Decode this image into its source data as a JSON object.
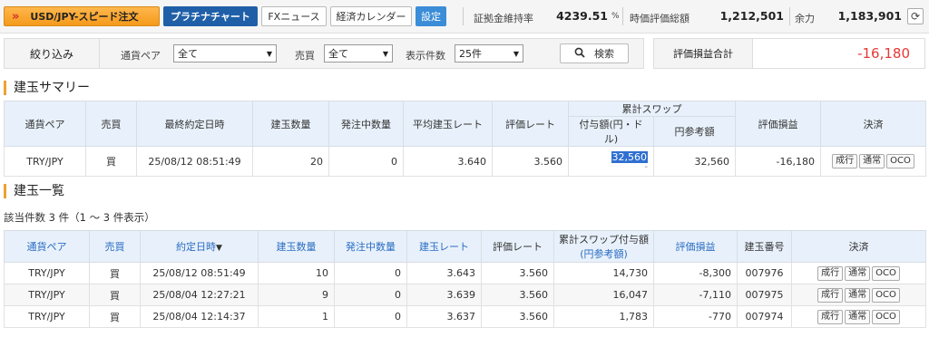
{
  "topbar": {
    "speed_order_label": "USD/JPY-スピード注文",
    "platinum_chart_label": "プラチナチャート",
    "fx_news_label": "FXニュース",
    "econ_calendar_label": "経済カレンダー",
    "settings_label": "設定",
    "margin_rate_label": "証拠金維持率",
    "margin_rate_value": "4239.51",
    "margin_rate_unit": "%",
    "valuation_total_label": "時価評価総額",
    "valuation_total_value": "1,212,501",
    "available_label": "余力",
    "available_value": "1,183,901",
    "refresh_icon_glyph": "⟳"
  },
  "filter": {
    "title": "絞り込み",
    "pair_label": "通貨ペア",
    "pair_value": "全て",
    "side_label": "売買",
    "side_value": "全て",
    "count_label": "表示件数",
    "count_value": "25件",
    "search_label": "検索",
    "search_icon_glyph": "🔍"
  },
  "pl_total": {
    "label": "評価損益合計",
    "value": "-16,180"
  },
  "summary": {
    "title": "建玉サマリー",
    "headers": {
      "pair": "通貨ペア",
      "side": "売買",
      "last_date": "最終約定日時",
      "qty": "建玉数量",
      "pending": "発注中数量",
      "avg_rate": "平均建玉レート",
      "eval_rate": "評価レート",
      "swap_group": "累計スワップ",
      "swap_amount": "付与額(円・ドル)",
      "swap_yen": "円参考額",
      "pl": "評価損益",
      "settle": "決済"
    },
    "row": {
      "pair": "TRY/JPY",
      "side": "買",
      "last_date": "25/08/12 08:51:49",
      "qty": "20",
      "pending": "0",
      "avg_rate": "3.640",
      "eval_rate": "3.560",
      "swap_amount": "32,560",
      "swap_sub": "-",
      "swap_yen": "32,560",
      "pl": "-16,180"
    }
  },
  "positions": {
    "title": "建玉一覧",
    "count_text": "該当件数 3 件（1 ～ 3 件表示）",
    "headers": {
      "pair": "通貨ペア",
      "side": "売買",
      "date": "約定日時",
      "sort_glyph": "▼",
      "qty": "建玉数量",
      "pending": "発注中数量",
      "rate": "建玉レート",
      "eval_rate": "評価レート",
      "swap_line1": "累計スワップ付与額",
      "swap_line2": "(円参考額)",
      "pl": "評価損益",
      "id": "建玉番号",
      "settle": "決済"
    },
    "rows": [
      {
        "pair": "TRY/JPY",
        "side": "買",
        "date": "25/08/12 08:51:49",
        "qty": "10",
        "pending": "0",
        "rate": "3.643",
        "eval_rate": "3.560",
        "swap": "14,730",
        "pl": "-8,300",
        "id": "007976"
      },
      {
        "pair": "TRY/JPY",
        "side": "買",
        "date": "25/08/04 12:27:21",
        "qty": "9",
        "pending": "0",
        "rate": "3.639",
        "eval_rate": "3.560",
        "swap": "16,047",
        "pl": "-7,110",
        "id": "007975"
      },
      {
        "pair": "TRY/JPY",
        "side": "買",
        "date": "25/08/04 12:14:37",
        "qty": "1",
        "pending": "0",
        "rate": "3.637",
        "eval_rate": "3.560",
        "swap": "1,783",
        "pl": "-770",
        "id": "007974"
      }
    ]
  },
  "settle_buttons": {
    "market": "成行",
    "normal": "通常",
    "oco": "OCO"
  },
  "colors": {
    "accent_orange": "#f49a1a",
    "platinum_blue": "#1f5fa8",
    "settings_blue": "#3c8dd8",
    "negative_red": "#e53935",
    "header_blue_bg": "#e8f1fb"
  }
}
